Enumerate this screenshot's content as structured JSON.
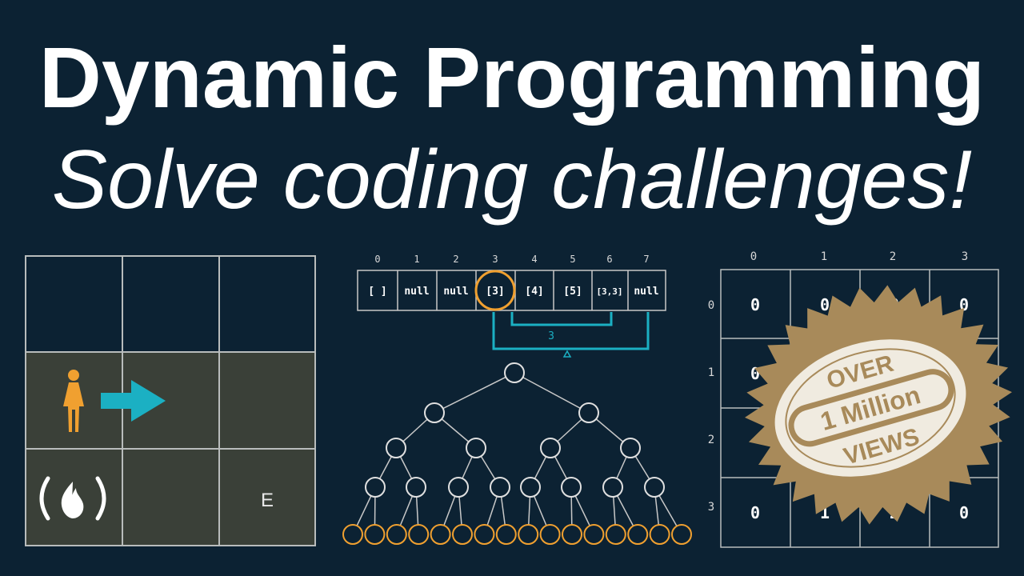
{
  "title": {
    "line1": "Dynamic Programming",
    "line2": "Solve coding challenges!"
  },
  "grid_panel": {
    "end_label": "E"
  },
  "memo_panel": {
    "indices": [
      "0",
      "1",
      "2",
      "3",
      "4",
      "5",
      "6",
      "7"
    ],
    "cells": [
      "[ ]",
      "null",
      "null",
      "[3]",
      "[4]",
      "[5]",
      "[3,3]",
      "null"
    ],
    "bracket_label": "3"
  },
  "matrix_panel": {
    "col_headers": [
      "0",
      "1",
      "2",
      "3"
    ],
    "row_headers": [
      "0",
      "1",
      "2",
      "3"
    ],
    "visible_values": {
      "r0": [
        "0",
        "0",
        "0",
        "0"
      ],
      "r1": [
        "0"
      ],
      "r3": [
        "0",
        "1",
        "2",
        "0"
      ]
    }
  },
  "badge": {
    "top": "OVER",
    "middle": "1 Million",
    "bottom": "VIEWS"
  },
  "colors": {
    "background": "#0c2233",
    "grid_filled": "#3a4038",
    "accent_orange": "#f0a030",
    "accent_teal": "#1bb0c3",
    "badge_gold": "#a88a5a",
    "badge_cream": "#f0ebe0"
  },
  "icons": [
    "person-icon",
    "arrow-right-icon",
    "freecodecamp-logo-icon"
  ]
}
